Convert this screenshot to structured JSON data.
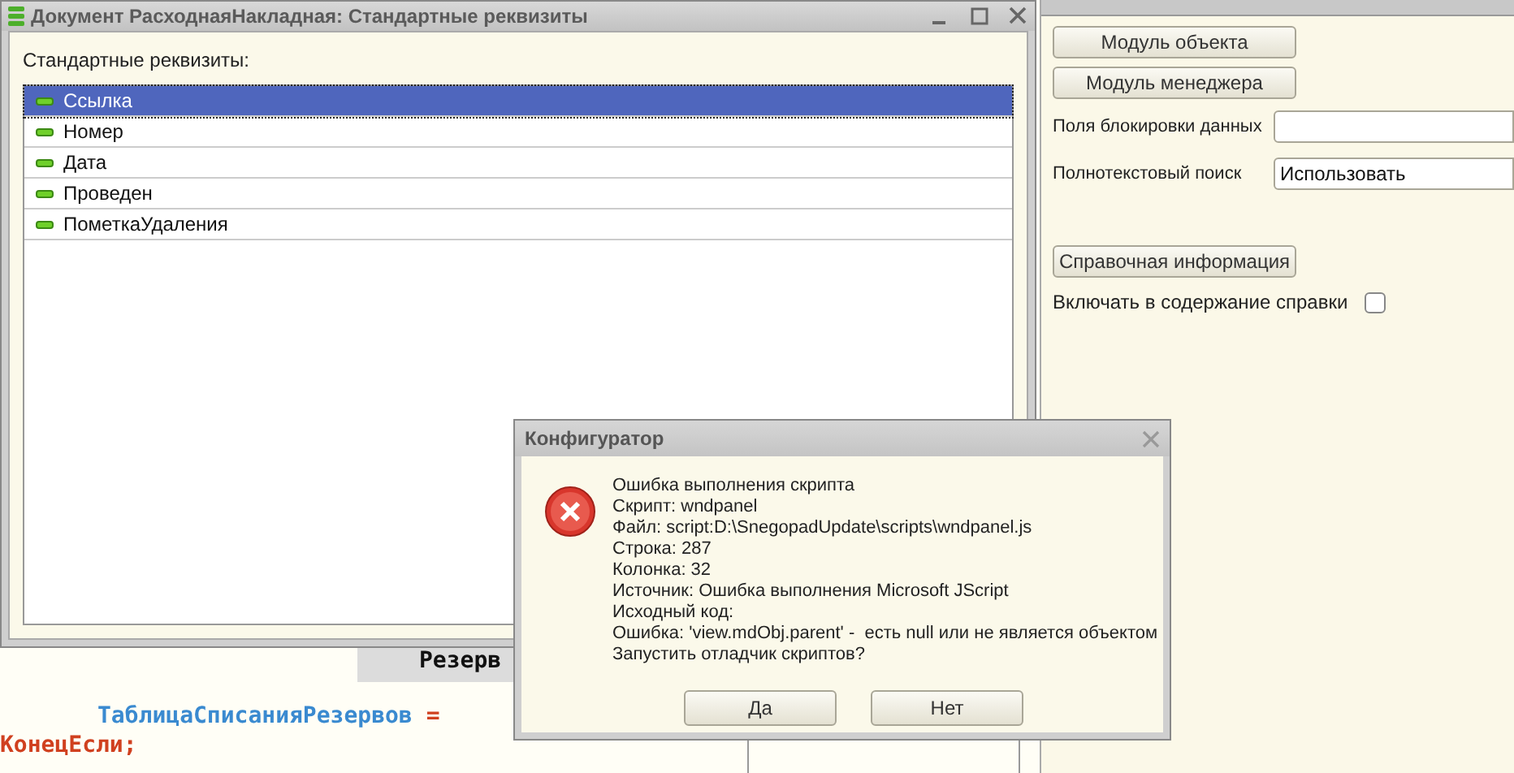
{
  "code_editor": {
    "lines": [
      {
        "kind": "highlight",
        "text": "Резерв"
      },
      {
        "kind": "assign",
        "identifier": "ТаблицаСписанияРезервов",
        "operator": "="
      },
      {
        "kind": "keyword",
        "text": "КонецЕсли;"
      }
    ]
  },
  "properties_panel": {
    "module_buttons": [
      "Модуль объекта",
      "Модуль менеджера"
    ],
    "fields": [
      {
        "label": "Поля блокировки данных"
      },
      {
        "label": "Полнотекстовый поиск",
        "value": "Использовать"
      }
    ],
    "help_button": "Справочная информация",
    "help_checkbox": {
      "label": "Включать в содержание справки",
      "checked": false
    }
  },
  "window": {
    "title": "Документ РасходнаяНакладная: Стандартные реквизиты",
    "list_label": "Стандартные реквизиты:",
    "items": [
      {
        "label": "Ссылка",
        "selected": true
      },
      {
        "label": "Номер",
        "selected": false
      },
      {
        "label": "Дата",
        "selected": false
      },
      {
        "label": "Проведен",
        "selected": false
      },
      {
        "label": "ПометкаУдаления",
        "selected": false
      }
    ]
  },
  "dialog": {
    "title": "Конфигуратор",
    "lines": [
      "Ошибка выполнения скрипта",
      "Скрипт: wndpanel",
      "Файл: script:D:\\SnegopadUpdate\\scripts\\wndpanel.js",
      "Строка: 287",
      "Колонка: 32",
      "Источник: Ошибка выполнения Microsoft JScript",
      "Исходный код:",
      "Ошибка: 'view.mdObj.parent' -  есть null или не является объектом",
      "Запустить отладчик скриптов?"
    ],
    "buttons": [
      "Да",
      "Нет"
    ]
  }
}
